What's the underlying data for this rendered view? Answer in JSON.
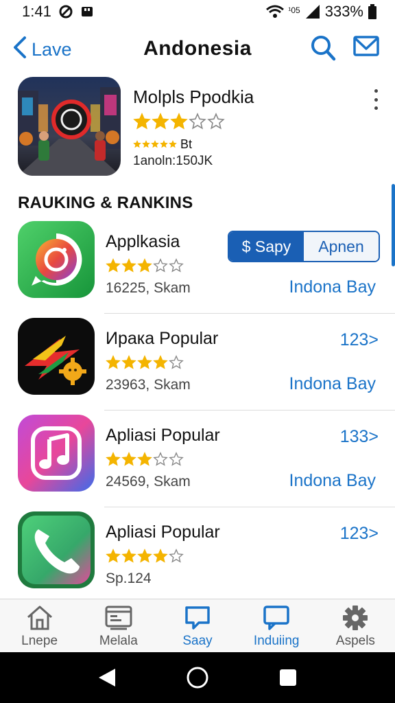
{
  "status_bar": {
    "time": "1:41",
    "network_label": "¹05",
    "battery": "333%"
  },
  "header": {
    "back_label": "Lave",
    "title": "Andonesia"
  },
  "featured": {
    "name": "Molpls Ppodkia",
    "rating": 3,
    "max_rating": 5,
    "sub_label": "Bt",
    "downloads": "1anoln:150JK"
  },
  "section": {
    "title": "RAUKING & RANKINS"
  },
  "apps": [
    {
      "name": "Applkasia",
      "rating": 3,
      "meta": "16225, Skam",
      "region": "Indona Bay",
      "segment": {
        "active": "$ Sapy",
        "inactive": "Apnen"
      }
    },
    {
      "name": "Ирака Popular",
      "rating": 4,
      "meta": "23963, Skam",
      "rank": "123>",
      "region": "Indona Bay"
    },
    {
      "name": "Apliasi Popular",
      "rating": 3,
      "meta": "24569, Skam",
      "rank": "133>",
      "region": "Indona Bay"
    },
    {
      "name": "Apliasi Popular",
      "rating": 4,
      "meta": "Sp.124",
      "rank": "123>"
    }
  ],
  "tabs": [
    {
      "label": "Lnepe",
      "icon": "home-icon"
    },
    {
      "label": "Melala",
      "icon": "media-icon"
    },
    {
      "label": "Saay",
      "icon": "chat-icon",
      "active": true
    },
    {
      "label": "Induiing",
      "icon": "message-icon",
      "active": true
    },
    {
      "label": "Aspels",
      "icon": "gear-icon"
    }
  ],
  "colors": {
    "accent": "#1a73c8",
    "star": "#f4b400",
    "segment": "#1a5fb4"
  }
}
